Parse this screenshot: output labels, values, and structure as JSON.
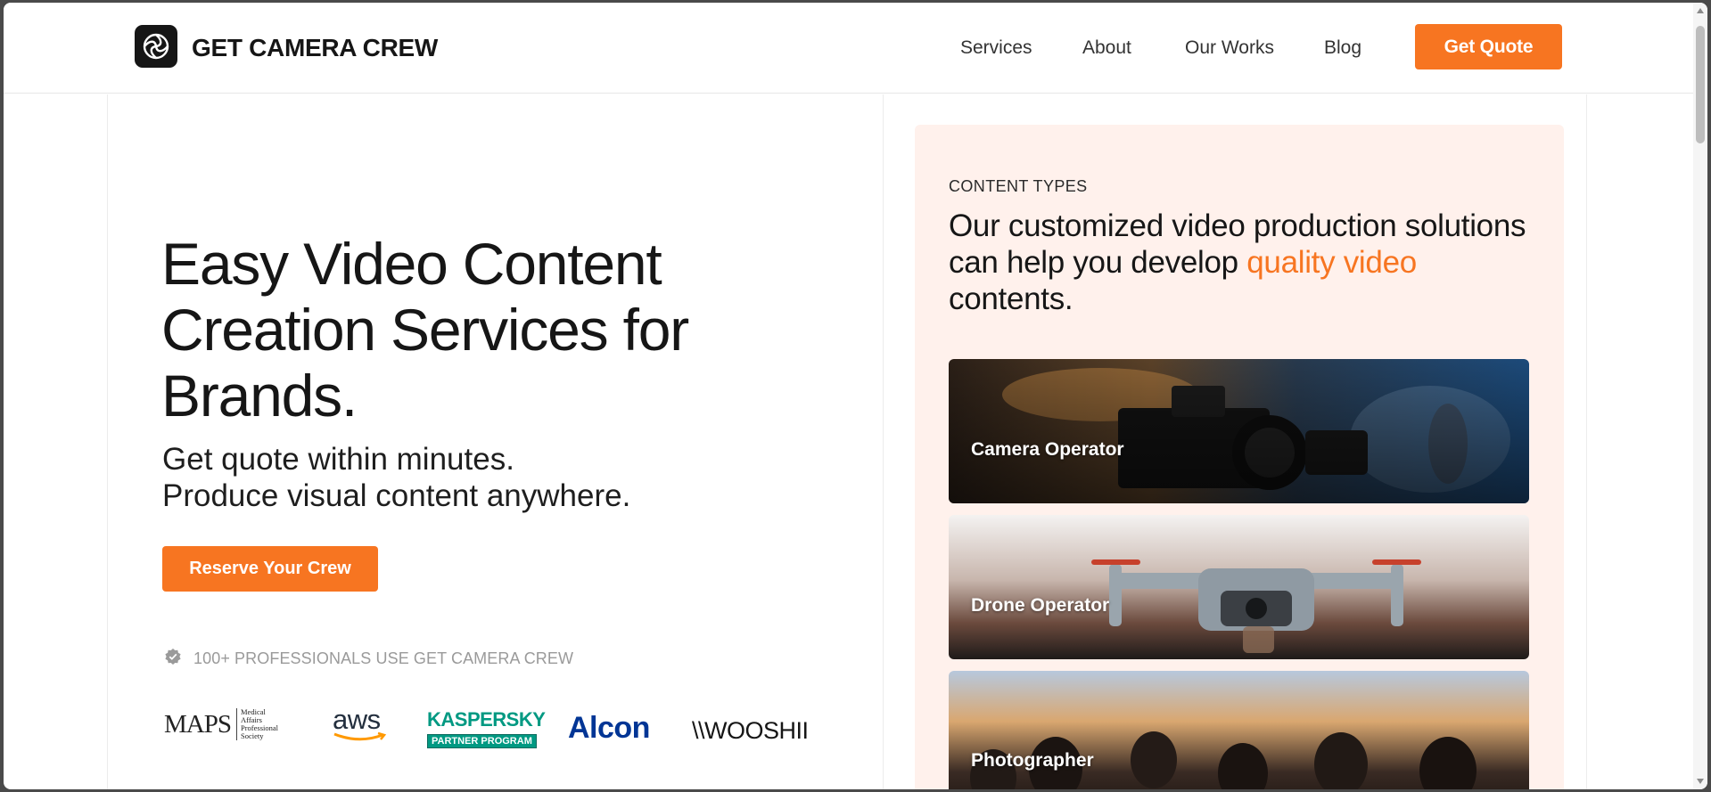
{
  "header": {
    "brand": "GET CAMERA CREW",
    "nav": [
      "Services",
      "About",
      "Our Works",
      "Blog"
    ],
    "cta": "Get Quote"
  },
  "hero": {
    "title": "Easy Video Content Creation Services for Brands.",
    "sub_line1": "Get quote within minutes.",
    "sub_line2": "Produce visual content anywhere.",
    "cta": "Reserve Your Crew",
    "professionals": "100+ PROFESSIONALS USE GET CAMERA CREW"
  },
  "clients": {
    "maps": "MAPS",
    "maps_caption_1": "Medical",
    "maps_caption_2": "Affairs",
    "maps_caption_3": "Professional",
    "maps_caption_4": "Society",
    "aws": "aws",
    "kaspersky": "KASPERSKY",
    "kaspersky_badge": "PARTNER PROGRAM",
    "alcon": "Alcon",
    "wooshii": "\\\\WOOSHII"
  },
  "panel": {
    "eyebrow": "CONTENT TYPES",
    "heading_part1": "Our customized video production solutions can help you develop ",
    "heading_accent": "quality video",
    "heading_part2": " contents.",
    "cards": [
      "Camera Operator",
      "Drone Operator",
      "Photographer"
    ]
  },
  "colors": {
    "accent": "#f77521",
    "panel_bg": "#fff1ec",
    "dark": "#161616"
  },
  "icons": [
    "aperture-logo-icon",
    "verified-badge-icon"
  ]
}
